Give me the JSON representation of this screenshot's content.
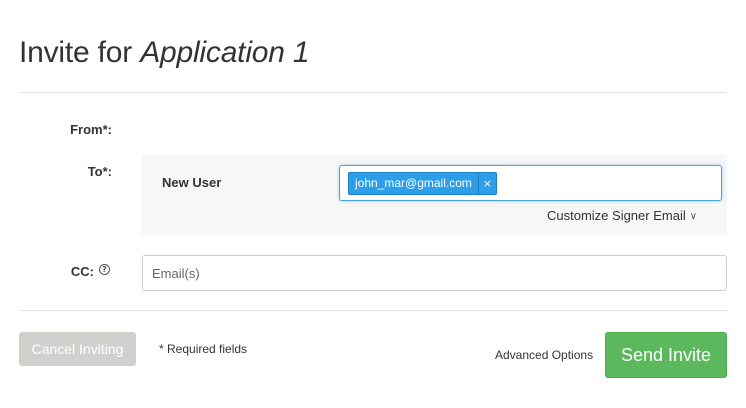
{
  "header": {
    "title_prefix": "Invite for ",
    "application_name": "Application 1"
  },
  "form": {
    "from_label": "From*:",
    "to_label": "To*:",
    "cc_label": "CC:",
    "help_glyph": "?",
    "signer": {
      "name": "New User",
      "email_chip": "john_mar@gmail.com",
      "chip_remove_glyph": "×",
      "customize_label": "Customize Signer Email",
      "chevron_glyph": "∨"
    },
    "cc_placeholder": "Email(s)",
    "cc_value": ""
  },
  "footer": {
    "cancel_label": "Cancel Inviting",
    "required_note": "* Required fields",
    "advanced_label": "Advanced Options",
    "send_label": "Send Invite"
  },
  "colors": {
    "send_green": "#5cb85c",
    "chip_blue": "#2d9ee8",
    "cancel_gray": "#d2d0cd",
    "focus_blue": "#4aa3df"
  }
}
